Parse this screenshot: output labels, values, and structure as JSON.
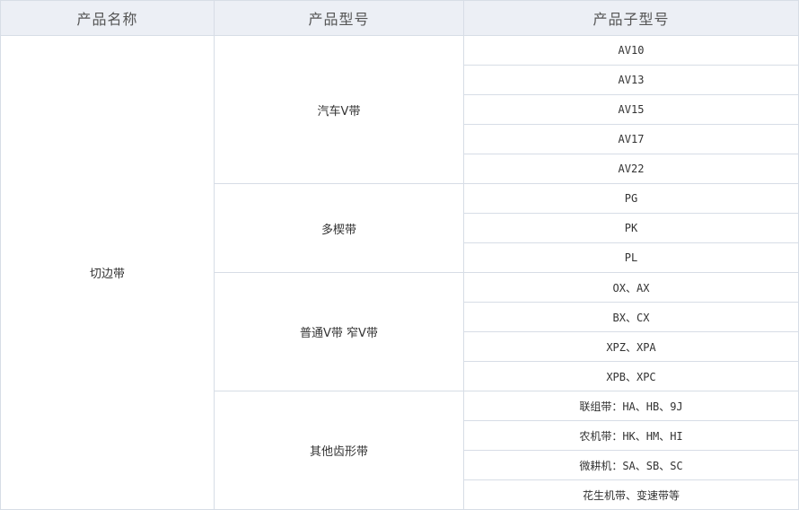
{
  "table": {
    "headers": [
      "产品名称",
      "产品型号",
      "产品子型号"
    ],
    "product_name": "切边带",
    "groups": [
      {
        "model": "汽车V带",
        "subs": [
          "AV10",
          "AV13",
          "AV15",
          "AV17",
          "AV22"
        ]
      },
      {
        "model": "多楔带",
        "subs": [
          "PG",
          "PK",
          "PL"
        ]
      },
      {
        "model": "普通V带 窄V带",
        "subs": [
          "OX、AX",
          "BX、CX",
          "XPZ、XPA",
          "XPB、XPC"
        ]
      },
      {
        "model": "其他齿形带",
        "subs": [
          "联组带：HA、HB、9J",
          "农机带：HK、HM、HI",
          "微耕机：SA、SB、SC",
          "花生机带、变速带等"
        ]
      }
    ]
  }
}
